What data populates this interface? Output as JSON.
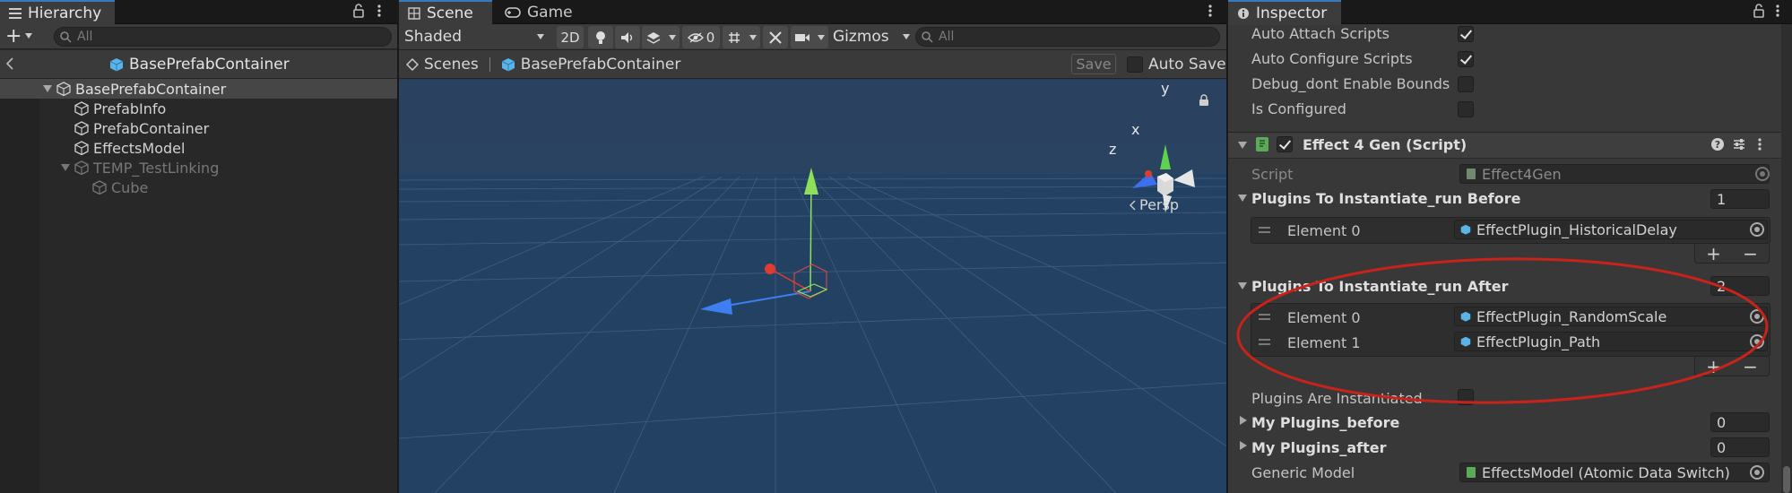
{
  "hierarchy": {
    "tab_label": "Hierarchy",
    "add_label": "+",
    "search_placeholder": "All",
    "header_title": "BasePrefabContainer",
    "items": [
      {
        "label": "BasePrefabContainer"
      },
      {
        "label": "PrefabInfo"
      },
      {
        "label": "PrefabContainer"
      },
      {
        "label": "EffectsModel"
      },
      {
        "label": "TEMP_TestLinking"
      },
      {
        "label": "Cube"
      }
    ]
  },
  "scene": {
    "tab_scene": "Scene",
    "tab_game": "Game",
    "shading_mode": "Shaded",
    "toggle_2d": "2D",
    "hidden_count": "0",
    "gizmos_label": "Gizmos",
    "search_placeholder": "All",
    "breadcrumb_scenes": "Scenes",
    "breadcrumb_current": "BasePrefabContainer",
    "save_label": "Save",
    "auto_save_label": "Auto Save",
    "gizmo_y": "y",
    "gizmo_x": "x",
    "gizmo_z": "z",
    "projection_label": "Persp"
  },
  "inspector": {
    "tab_label": "Inspector",
    "props_top": [
      {
        "label": "Auto Attach Scripts",
        "checked": true
      },
      {
        "label": "Auto Configure Scripts",
        "checked": true
      },
      {
        "label": "Debug_dont Enable Bounds",
        "checked": false
      },
      {
        "label": "Is Configured",
        "checked": false
      }
    ],
    "component_title": "Effect 4 Gen (Script)",
    "script_label": "Script",
    "script_value": "Effect4Gen",
    "before": {
      "label": "Plugins To Instantiate_run Before",
      "count": "1",
      "elements": [
        {
          "label": "Element 0",
          "value": "EffectPlugin_HistoricalDelay"
        }
      ]
    },
    "after": {
      "label": "Plugins To Instantiate_run After",
      "count": "2",
      "elements": [
        {
          "label": "Element 0",
          "value": "EffectPlugin_RandomScale"
        },
        {
          "label": "Element 1",
          "value": "EffectPlugin_Path"
        }
      ]
    },
    "plus_label": "+",
    "minus_label": "−",
    "plugins_instantiated_label": "Plugins Are Instantiated",
    "my_before_label": "My Plugins_before",
    "my_before_count": "0",
    "my_after_label": "My Plugins_after",
    "my_after_count": "0",
    "generic_model_label": "Generic Model",
    "generic_model_value": "EffectsModel (Atomic Data Switch)"
  },
  "colors": {
    "accent_blue": "#3a79bb",
    "annotation_red": "#c8231b",
    "scene_sky": "#2a4260"
  }
}
